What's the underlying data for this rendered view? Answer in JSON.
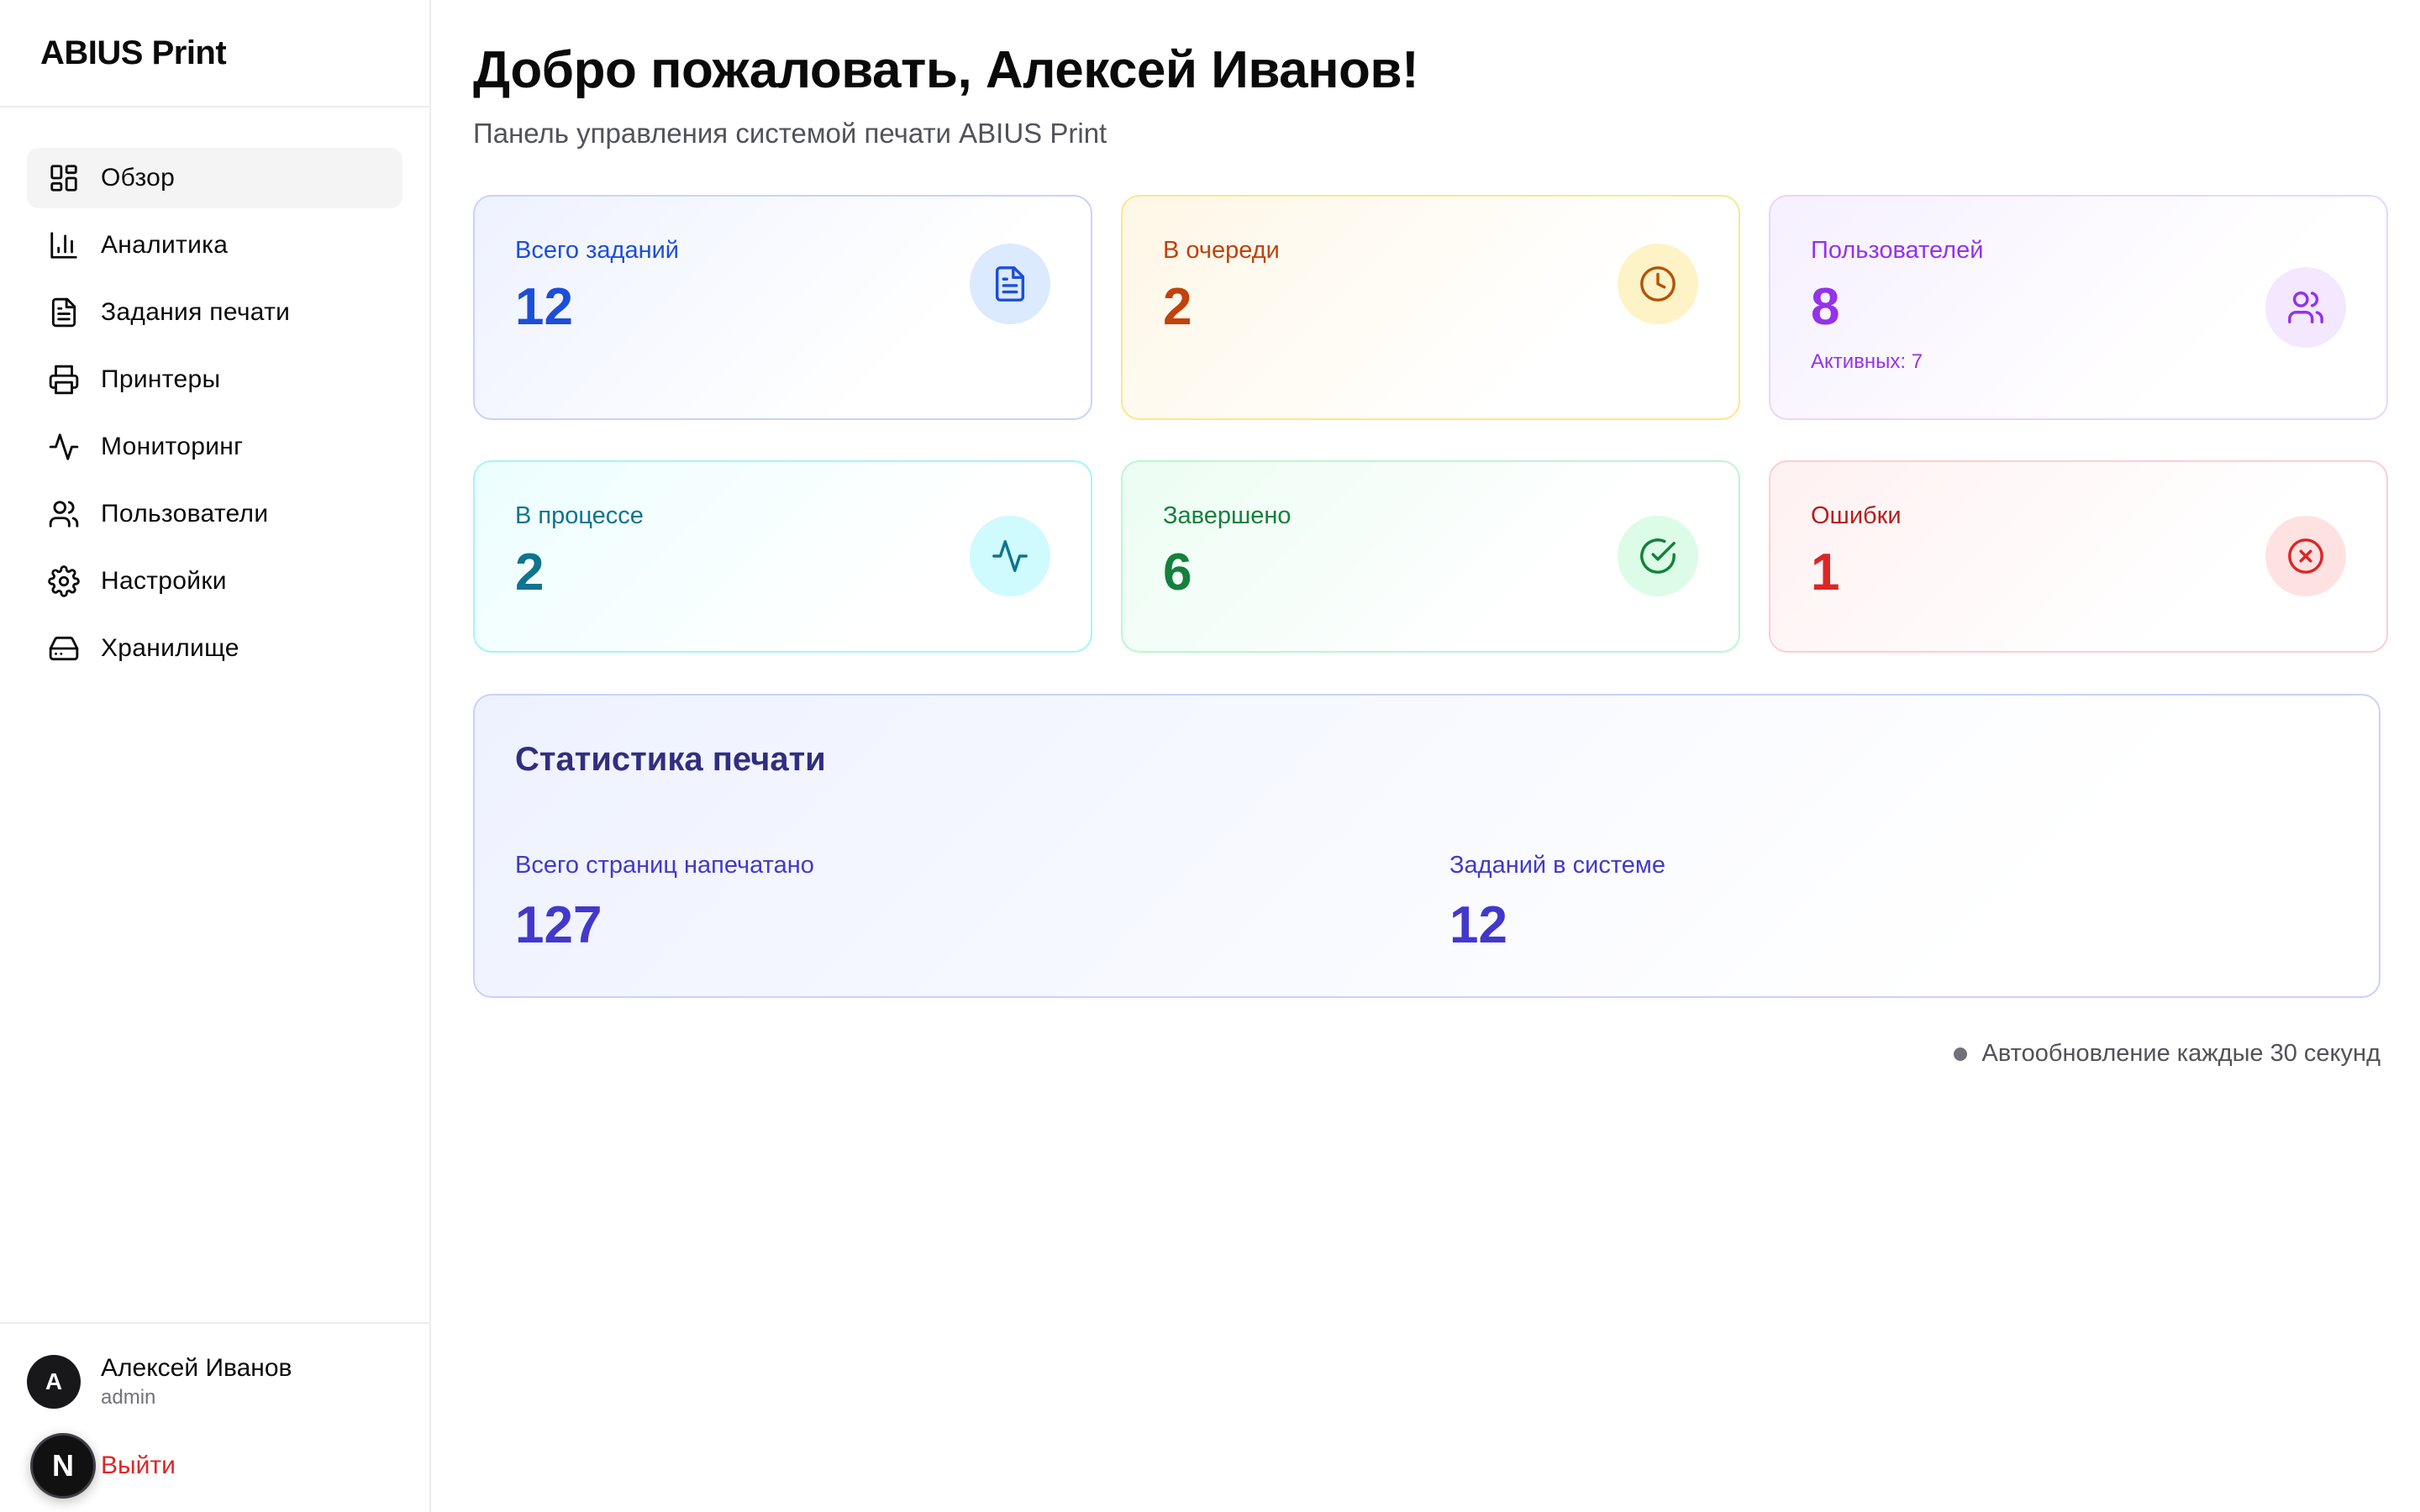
{
  "app": {
    "title": "ABIUS Print"
  },
  "sidebar": {
    "items": [
      {
        "label": "Обзор",
        "icon": "dashboard-icon",
        "active": true
      },
      {
        "label": "Аналитика",
        "icon": "bar-chart-icon"
      },
      {
        "label": "Задания печати",
        "icon": "document-icon"
      },
      {
        "label": "Принтеры",
        "icon": "printer-icon"
      },
      {
        "label": "Мониторинг",
        "icon": "activity-icon"
      },
      {
        "label": "Пользователи",
        "icon": "users-icon"
      },
      {
        "label": "Настройки",
        "icon": "gear-icon"
      },
      {
        "label": "Хранилище",
        "icon": "hard-drive-icon"
      }
    ]
  },
  "user": {
    "initial": "A",
    "name": "Алексей Иванов",
    "role": "admin",
    "logout_label": "Выйти",
    "badge": "N"
  },
  "header": {
    "title": "Добро пожаловать, Алексей Иванов!",
    "subtitle": "Панель управления системой печати ABIUS Print"
  },
  "cards": [
    {
      "label": "Всего заданий",
      "value": "12",
      "icon": "file-text-icon",
      "color": "#1d4ed8",
      "icon_bg": "#dbeafe"
    },
    {
      "label": "В очереди",
      "value": "2",
      "icon": "clock-icon",
      "color": "#c2410c",
      "icon_bg": "#fef3c7"
    },
    {
      "label": "Пользователей",
      "value": "8",
      "sub": "Активных: 7",
      "icon": "users-icon",
      "color": "#9333ea",
      "icon_bg": "#f3e8ff"
    },
    {
      "label": "В процессе",
      "value": "2",
      "icon": "activity-icon",
      "color": "#0e7490",
      "icon_bg": "#cffafe"
    },
    {
      "label": "Завершено",
      "value": "6",
      "icon": "check-circle-icon",
      "color": "#15803d",
      "icon_bg": "#dcfce7"
    },
    {
      "label": "Ошибки",
      "value": "1",
      "icon": "x-circle-icon",
      "color": "#dc2626",
      "icon_bg": "#fee2e2"
    }
  ],
  "stats": {
    "title": "Статистика печати",
    "pages_label": "Всего страниц напечатано",
    "pages_value": "127",
    "jobs_label": "Заданий в системе",
    "jobs_value": "12"
  },
  "footer": {
    "autoupdate": "Автообновление каждые 30 секунд"
  }
}
